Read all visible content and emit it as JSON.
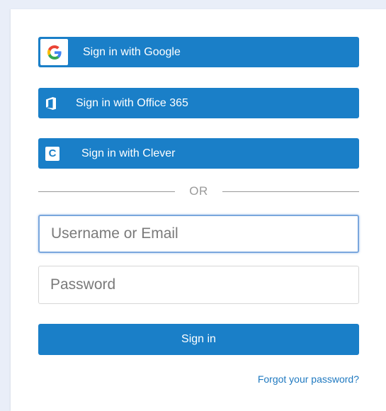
{
  "sso": {
    "google_label": "Sign in with Google",
    "office_label": "Sign in with Office 365",
    "clever_label": "Sign in with Clever",
    "clever_icon_letter": "C"
  },
  "divider": {
    "text": "OR"
  },
  "form": {
    "username_placeholder": "Username or Email",
    "password_placeholder": "Password",
    "signin_label": "Sign in",
    "forgot_label": "Forgot your password?"
  },
  "icons": {
    "google": "google-logo-icon",
    "office": "office-365-icon",
    "clever": "clever-icon"
  },
  "colors": {
    "primary": "#1a7fc8",
    "link": "#1f79c0",
    "focus_border": "#7aa7dd",
    "page_background": "#e9eef8"
  }
}
